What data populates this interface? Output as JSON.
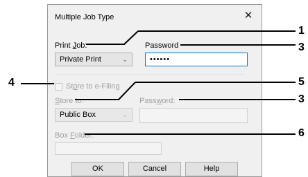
{
  "dialog": {
    "title": "Multiple Job Type",
    "close_glyph": "✕",
    "print_job": {
      "label_pre": "Print ",
      "label_u": "J",
      "label_post": "ob:",
      "value": "Private Print"
    },
    "password1": {
      "label": "Password",
      "value": "••••••"
    },
    "store": {
      "label_pre": "St",
      "label_u": "o",
      "label_post": "re to e-Filing",
      "checked": false
    },
    "store_to": {
      "label_u": "S",
      "label_post": "tore to:",
      "value": "Public Box"
    },
    "password2": {
      "label_pre": "Pass",
      "label_u": "w",
      "label_post": "ord:",
      "value": ""
    },
    "box_folder": {
      "label_pre": "Box ",
      "label_u": "F",
      "label_post": "older:",
      "value": ""
    },
    "buttons": {
      "ok": "OK",
      "cancel": "Cancel",
      "help": "Help"
    }
  },
  "callouts": [
    "1",
    "3",
    "4",
    "5",
    "3",
    "6"
  ],
  "icons": {
    "chevron": "chevron-down-icon",
    "close": "close-icon"
  }
}
